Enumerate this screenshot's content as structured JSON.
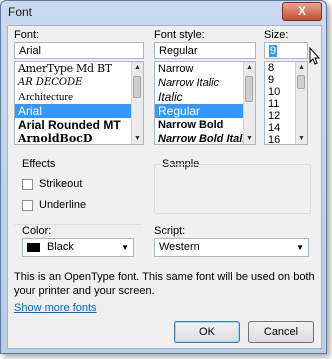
{
  "window": {
    "title": "Font",
    "close_label": "X"
  },
  "font": {
    "label": "Font:",
    "value": "Arial",
    "items": [
      "AmerType Md BT",
      "AR DECODE",
      "Architecture",
      "Arial",
      "Arial Rounded MT",
      "ArnoldBocD"
    ],
    "selected": "Arial"
  },
  "style": {
    "label": "Font style:",
    "value": "Regular",
    "items": [
      "Narrow",
      "Narrow Italic",
      "Italic",
      "Regular",
      "Narrow Bold",
      "Narrow Bold Italic"
    ],
    "selected": "Regular"
  },
  "size": {
    "label": "Size:",
    "value": "9",
    "items": [
      "8",
      "9",
      "10",
      "11",
      "12",
      "14",
      "16"
    ],
    "selected": "9"
  },
  "effects": {
    "label": "Effects",
    "strikeout": "Strikeout",
    "underline": "Underline",
    "color_label": "Color:",
    "color_value": "Black",
    "color_hex": "#000000"
  },
  "sample": {
    "label": "Sample"
  },
  "script": {
    "label": "Script:",
    "value": "Western"
  },
  "info_text": "This is an OpenType font. This same font will be used on both your printer and your screen.",
  "show_more_link": "Show more fonts",
  "buttons": {
    "ok": "OK",
    "cancel": "Cancel"
  }
}
